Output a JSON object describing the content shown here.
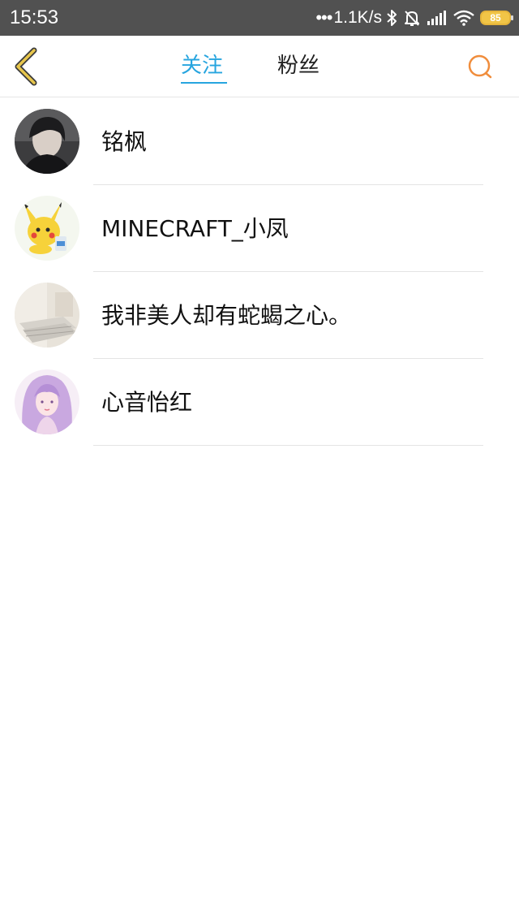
{
  "status_bar": {
    "time": "15:53",
    "dots": "•••",
    "net_speed": "1.1K/s",
    "battery": "85",
    "icons": [
      "bluetooth-icon",
      "mute-icon",
      "signal-icon",
      "wifi-icon",
      "battery-icon"
    ]
  },
  "nav": {
    "tabs": [
      {
        "label": "关注",
        "active": true
      },
      {
        "label": "粉丝",
        "active": false
      }
    ],
    "icons": [
      "back-arrow-icon",
      "search-icon"
    ]
  },
  "colors": {
    "accent": "#27a5df",
    "back_icon": "#e7c64c",
    "search_icon": "#f08d3c",
    "status_bar": "#515151"
  },
  "users": [
    {
      "name": "铭枫"
    },
    {
      "name": "MINECRAFT_小凤"
    },
    {
      "name": "我非美人却有蛇蝎之心。"
    },
    {
      "name": "心音怡红"
    }
  ]
}
